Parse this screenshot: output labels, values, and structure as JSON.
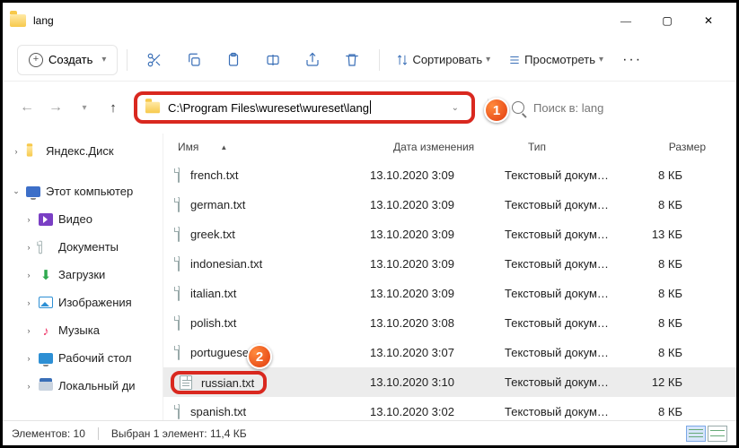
{
  "window": {
    "title": "lang"
  },
  "toolbar": {
    "create": "Создать",
    "sort": "Сортировать",
    "view": "Просмотреть"
  },
  "nav": {
    "path": "C:\\Program Files\\wureset\\wureset\\lang",
    "search_placeholder": "Поиск в: lang"
  },
  "badges": {
    "one": "1",
    "two": "2"
  },
  "sidebar": {
    "items": [
      {
        "label": "Яндекс.Диск",
        "expander": ">",
        "icon": "yadisk"
      },
      {
        "label": "Этот компьютер",
        "expander": "v",
        "icon": "pc"
      },
      {
        "label": "Видео",
        "expander": ">",
        "icon": "video"
      },
      {
        "label": "Документы",
        "expander": ">",
        "icon": "docs"
      },
      {
        "label": "Загрузки",
        "expander": ">",
        "icon": "downloads"
      },
      {
        "label": "Изображения",
        "expander": ">",
        "icon": "pictures"
      },
      {
        "label": "Музыка",
        "expander": ">",
        "icon": "music"
      },
      {
        "label": "Рабочий стол",
        "expander": ">",
        "icon": "desktop"
      },
      {
        "label": "Локальный ди",
        "expander": ">",
        "icon": "drive"
      }
    ]
  },
  "columns": {
    "name": "Имя",
    "date": "Дата изменения",
    "type": "Тип",
    "size": "Размер"
  },
  "files": [
    {
      "name": "french.txt",
      "date": "13.10.2020 3:09",
      "type": "Текстовый докум…",
      "size": "8 КБ"
    },
    {
      "name": "german.txt",
      "date": "13.10.2020 3:09",
      "type": "Текстовый докум…",
      "size": "8 КБ"
    },
    {
      "name": "greek.txt",
      "date": "13.10.2020 3:09",
      "type": "Текстовый докум…",
      "size": "13 КБ"
    },
    {
      "name": "indonesian.txt",
      "date": "13.10.2020 3:09",
      "type": "Текстовый докум…",
      "size": "8 КБ"
    },
    {
      "name": "italian.txt",
      "date": "13.10.2020 3:09",
      "type": "Текстовый докум…",
      "size": "8 КБ"
    },
    {
      "name": "polish.txt",
      "date": "13.10.2020 3:08",
      "type": "Текстовый докум…",
      "size": "8 КБ"
    },
    {
      "name": "portuguese.txt",
      "date": "13.10.2020 3:07",
      "type": "Текстовый докум…",
      "size": "8 КБ"
    },
    {
      "name": "russian.txt",
      "date": "13.10.2020 3:10",
      "type": "Текстовый докум…",
      "size": "12 КБ",
      "selected": true,
      "highlighted": true
    },
    {
      "name": "spanish.txt",
      "date": "13.10.2020 3:02",
      "type": "Текстовый докум…",
      "size": "8 КБ"
    }
  ],
  "status": {
    "count": "Элементов: 10",
    "selection": "Выбран 1 элемент: 11,4 КБ"
  }
}
